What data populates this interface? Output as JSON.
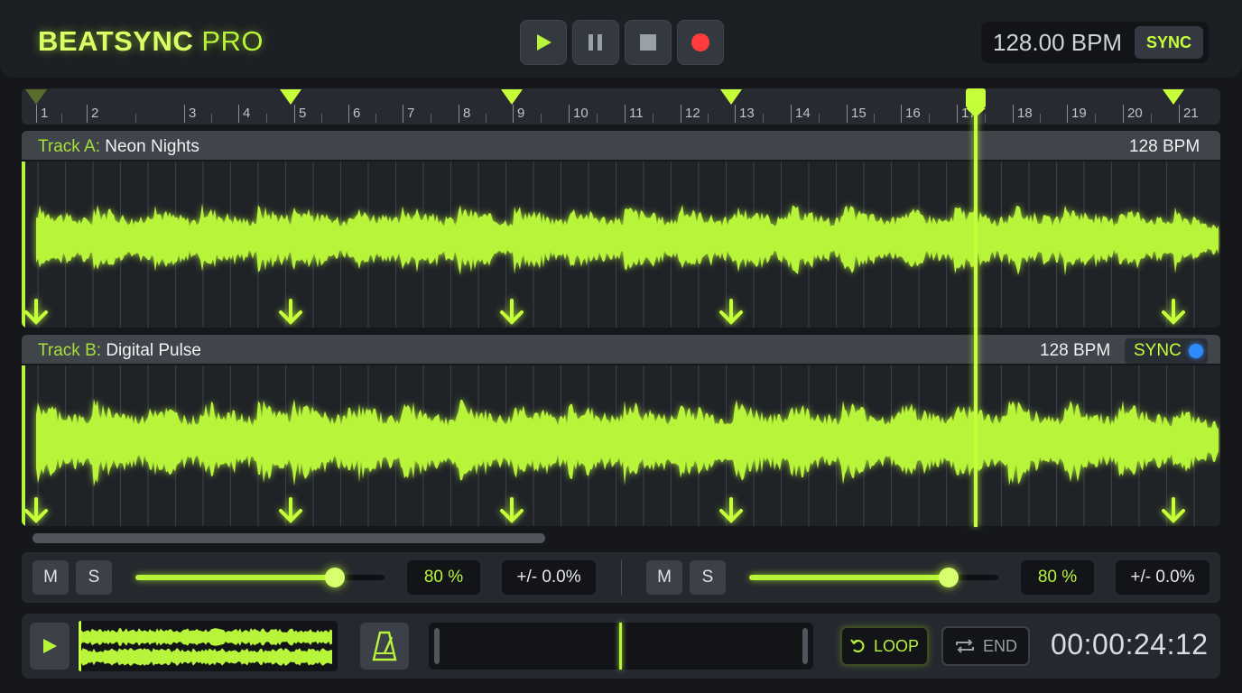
{
  "app": {
    "brand_main": "BEATSYNC",
    "brand_sub": "PRO"
  },
  "transport": {
    "play_icon": "play-icon",
    "pause_icon": "pause-icon",
    "stop_icon": "stop-icon",
    "record_icon": "record-icon"
  },
  "master": {
    "bpm": "128.00 BPM",
    "sync_label": "SYNC"
  },
  "ruler": {
    "bars": [
      "1",
      "2",
      "3",
      "4",
      "5",
      "6",
      "7",
      "8",
      "9",
      "10",
      "11",
      "12",
      "13",
      "14",
      "15",
      "16",
      "17",
      "18",
      "19",
      "20",
      "21"
    ]
  },
  "colors": {
    "accent": "#b8f53a",
    "sync_dot": "#2f8cff"
  },
  "track_a": {
    "label": "Track A:",
    "name": "Neon Nights",
    "bpm": "128 BPM"
  },
  "track_b": {
    "label": "Track B:",
    "name": "Digital Pulse",
    "bpm": "128 BPM",
    "sync_label": "SYNC",
    "sync_active": true
  },
  "mixer": {
    "deck_a": {
      "mute": "M",
      "solo": "S",
      "volume": 0.8,
      "volume_label": "80 %",
      "pitch": "+/- 0.0%"
    },
    "deck_b": {
      "mute": "M",
      "solo": "S",
      "volume": 0.8,
      "volume_label": "80 %",
      "pitch": "+/- 0.0%"
    }
  },
  "bottom": {
    "loop_label": "LOOP",
    "end_label": "END",
    "time": "00:00:24:12"
  }
}
